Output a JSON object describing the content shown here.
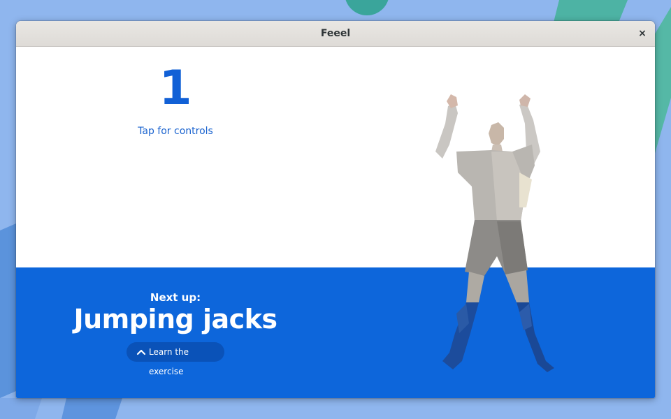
{
  "window": {
    "title": "Feeel",
    "close_glyph": "×"
  },
  "workout": {
    "counter": "1",
    "tap_hint": "Tap for controls",
    "next_label": "Next up:",
    "exercise_name": "Jumping jacks",
    "learn_button": "Learn the exercise"
  },
  "icons": {
    "close": "close-icon",
    "learn": "chevron-up-icon",
    "figure": "person-illustration"
  },
  "colors": {
    "accent": "#0d66db",
    "counter": "#1160d6",
    "desktop": "#8fb6ee"
  }
}
